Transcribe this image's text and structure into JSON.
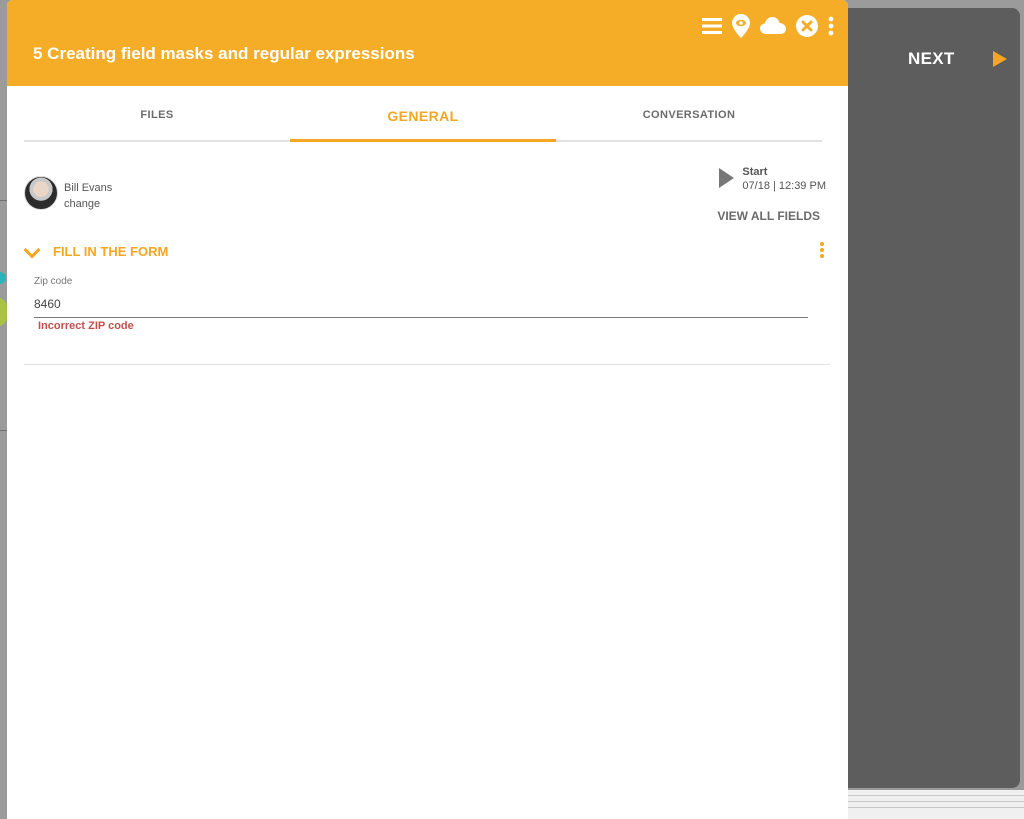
{
  "window": {
    "title": "5 Creating field masks and regular expressions",
    "icons": [
      "menu-icon",
      "location-icon",
      "cloud-icon",
      "close-icon",
      "more-icon"
    ]
  },
  "side_panel": {
    "next_label": "NEXT"
  },
  "tabs": [
    {
      "label": "FILES",
      "active": false
    },
    {
      "label": "GENERAL",
      "active": true
    },
    {
      "label": "CONVERSATION",
      "active": false
    }
  ],
  "user": {
    "name": "Bill Evans",
    "change_label": "change"
  },
  "start": {
    "label": "Start",
    "time": "07/18 | 12:39 PM",
    "view_all_label": "VIEW ALL FIELDS"
  },
  "form": {
    "section_title": "FILL IN THE FORM",
    "zip": {
      "label": "Zip code",
      "value": "8460",
      "error": "Incorrect ZIP code"
    }
  },
  "colors": {
    "accent": "#f5ad28",
    "error": "#c0504d",
    "panel": "#5d5d5d"
  }
}
